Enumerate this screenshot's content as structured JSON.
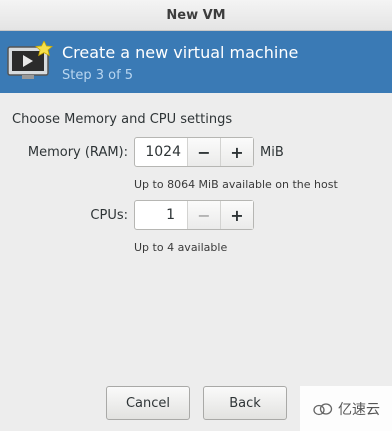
{
  "window": {
    "title": "New VM"
  },
  "banner": {
    "title": "Create a new virtual machine",
    "step": "Step 3 of 5",
    "icon": "monitor-star-icon",
    "background": "#3a7ab5"
  },
  "section": {
    "title": "Choose Memory and CPU settings"
  },
  "memory": {
    "label": "Memory (RAM):",
    "value": "1024",
    "unit": "MiB",
    "hint": "Up to 8064 MiB available on the host",
    "decrement": "−",
    "increment": "+"
  },
  "cpus": {
    "label": "CPUs:",
    "value": "1",
    "hint": "Up to 4 available",
    "decrement": "−",
    "increment": "+",
    "decrement_enabled": false
  },
  "buttons": {
    "cancel": "Cancel",
    "back": "Back"
  },
  "watermark": {
    "text": "亿速云"
  }
}
